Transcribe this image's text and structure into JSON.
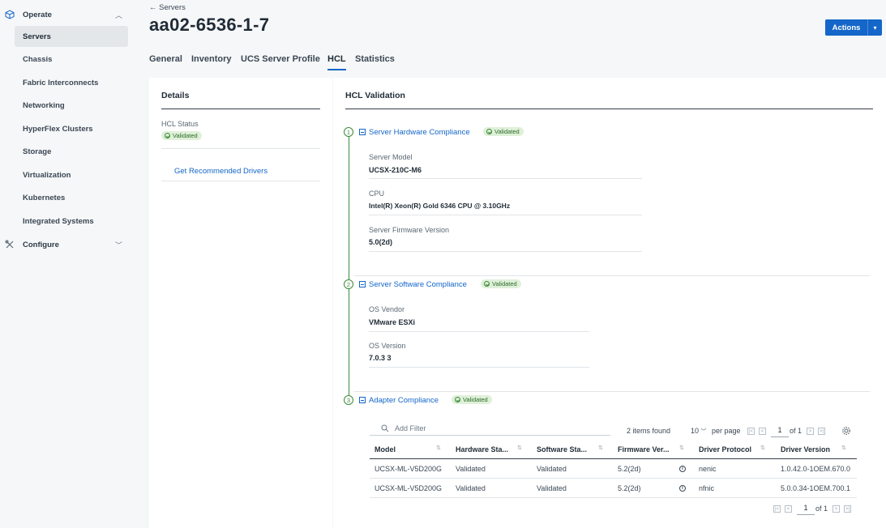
{
  "sidebar": {
    "operate_label": "Operate",
    "configure_label": "Configure",
    "items": [
      {
        "label": "Servers"
      },
      {
        "label": "Chassis"
      },
      {
        "label": "Fabric Interconnects"
      },
      {
        "label": "Networking"
      },
      {
        "label": "HyperFlex Clusters"
      },
      {
        "label": "Storage"
      },
      {
        "label": "Virtualization"
      },
      {
        "label": "Kubernetes"
      },
      {
        "label": "Integrated Systems"
      }
    ]
  },
  "header": {
    "back_label": "← Servers",
    "title": "aa02-6536-1-7",
    "actions_label": "Actions"
  },
  "tabs": [
    {
      "label": "General"
    },
    {
      "label": "Inventory"
    },
    {
      "label": "UCS Server Profile"
    },
    {
      "label": "HCL"
    },
    {
      "label": "Statistics"
    }
  ],
  "details": {
    "title": "Details",
    "hcl_status_label": "HCL Status",
    "hcl_status_value": "Validated",
    "recommended_drivers_link": "Get Recommended Drivers"
  },
  "hcl": {
    "title": "HCL Validation",
    "sections": [
      {
        "step": "1",
        "title": "Server Hardware Compliance",
        "status": "Validated",
        "fields": [
          {
            "label": "Server Model",
            "value": "UCSX-210C-M6"
          },
          {
            "label": "CPU",
            "value": "Intel(R) Xeon(R) Gold 6346 CPU @ 3.10GHz"
          },
          {
            "label": "Server Firmware Version",
            "value": "5.0(2d)"
          }
        ]
      },
      {
        "step": "2",
        "title": "Server Software Compliance",
        "status": "Validated",
        "fields": [
          {
            "label": "OS Vendor",
            "value": "VMware ESXi"
          },
          {
            "label": "OS Version",
            "value": "7.0.3 3"
          }
        ]
      },
      {
        "step": "3",
        "title": "Adapter Compliance",
        "status": "Validated"
      }
    ]
  },
  "adapter_table": {
    "filter_placeholder": "Add Filter",
    "items_found": "2 items found",
    "per_page_value": "10",
    "per_page_label": "per page",
    "page": "1",
    "of_pages": "of 1",
    "columns": [
      "Model",
      "Hardware Sta...",
      "Software Sta...",
      "Firmware Ver...",
      "Driver Protocol",
      "Driver Version"
    ],
    "rows": [
      [
        "UCSX-ML-V5D200G",
        "Validated",
        "Validated",
        "5.2(2d)",
        "nenic",
        "1.0.42.0-1OEM.670.0"
      ],
      [
        "UCSX-ML-V5D200G",
        "Validated",
        "Validated",
        "5.2(2d)",
        "nfnic",
        "5.0.0.34-1OEM.700.1"
      ]
    ]
  },
  "colors": {
    "accent": "#1466c9",
    "success": "#3b8a3b",
    "badge_bg": "#dff0d8"
  }
}
